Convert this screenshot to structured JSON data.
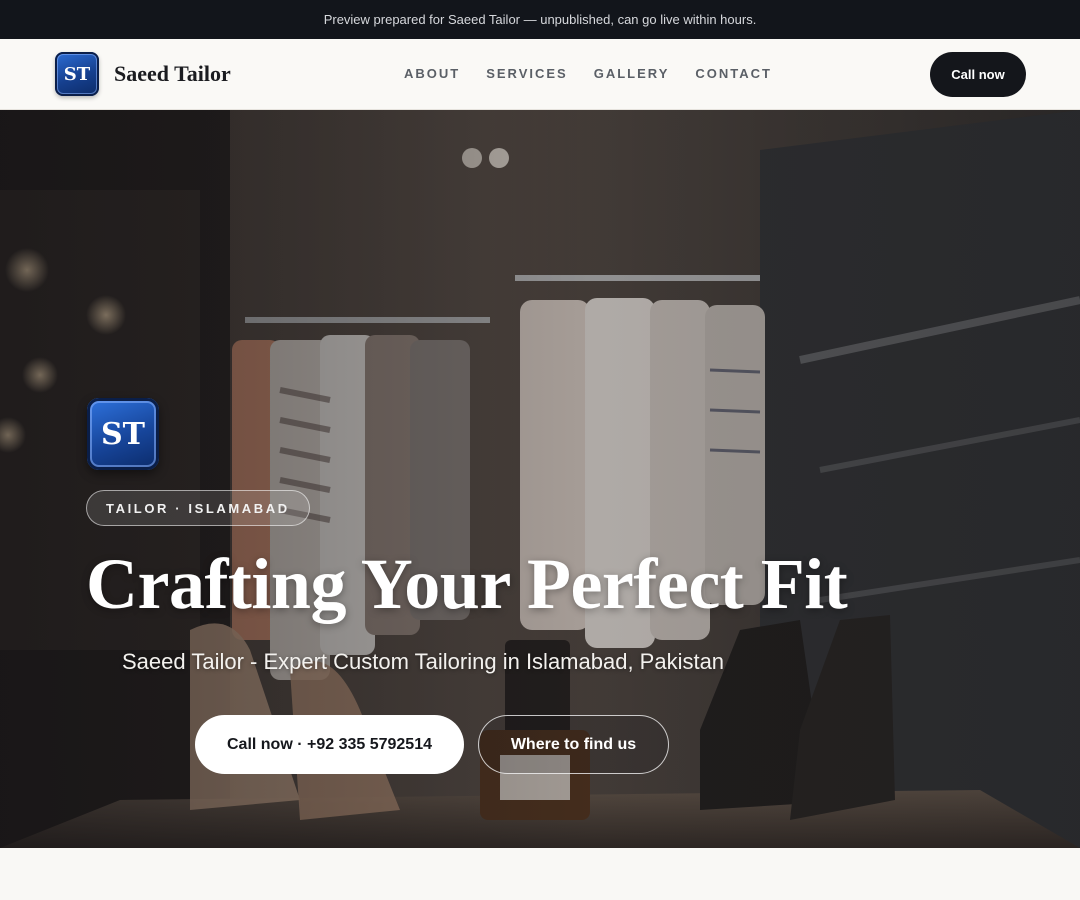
{
  "banner": {
    "text": "Preview prepared for Saeed Tailor — unpublished, can go live within hours."
  },
  "nav": {
    "logo_initials": "ST",
    "brand_name": "Saeed Tailor",
    "links": [
      "ABOUT",
      "SERVICES",
      "GALLERY",
      "CONTACT"
    ],
    "cta_label": "Call now"
  },
  "hero": {
    "logo_initials": "ST",
    "tag": "TAILOR · ISLAMABAD",
    "title": "Crafting Your Perfect Fit",
    "subtitle": "Saeed Tailor - Expert Custom Tailoring in Islamabad, Pakistan",
    "primary_button": "Call now · +92 335 5792514",
    "secondary_button": "Where to find us",
    "background_icon": "clothing-store-photo"
  },
  "colors": {
    "banner_bg": "#12151b",
    "nav_bg": "#faf9f6",
    "cta_bg": "#14161b",
    "logo_blue": "#17459a",
    "page_bg": "#f8f7f4"
  }
}
